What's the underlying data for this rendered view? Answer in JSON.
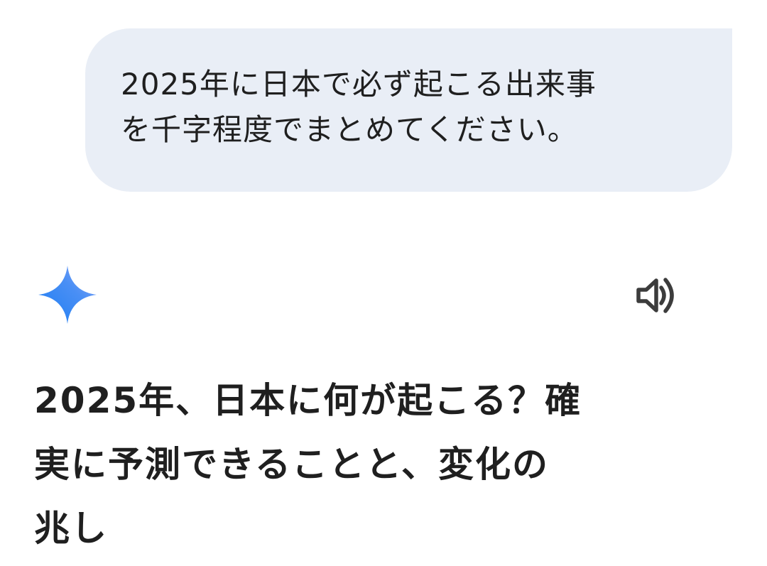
{
  "user_message": {
    "lines": [
      "2025年に日本で必ず起こる出来事",
      "を千字程度でまとめてください。"
    ]
  },
  "assistant": {
    "logo_icon": "gemini-sparkle-icon",
    "speaker_icon": "volume-icon",
    "title_lines": [
      "2025年、日本に何が起こる？確",
      "実に予測できることと、変化の",
      "兆し"
    ]
  },
  "colors": {
    "bubble_bg": "#e9eef6",
    "text": "#1f1f1f",
    "sparkle_start": "#4285f4",
    "sparkle_end": "#9b72cb"
  }
}
